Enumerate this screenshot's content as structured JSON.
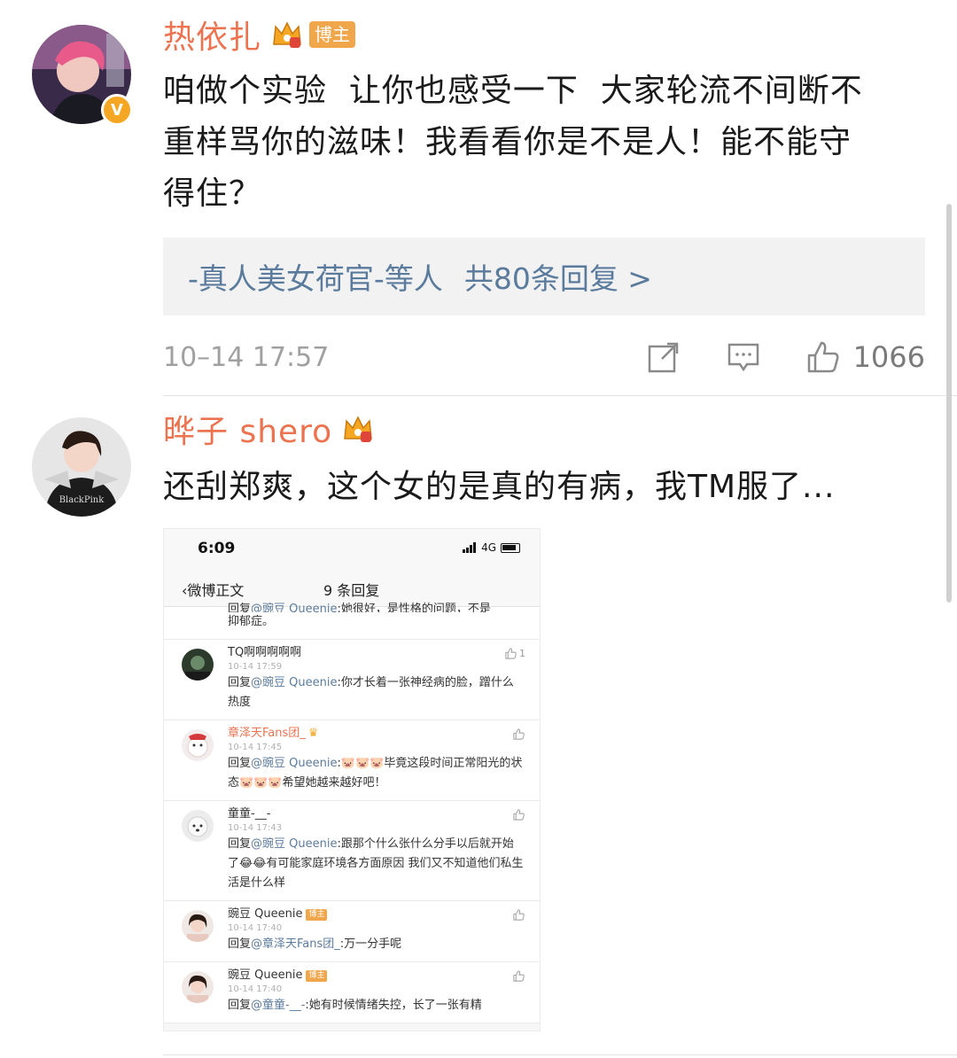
{
  "comments": [
    {
      "username": "热依扎",
      "tag": "博主",
      "verified_badge": "V",
      "lines": [
        "咱做个实验  让你也感受一下  大家轮流不间断不",
        "重样骂你的滋味！我看看你是不是人！能不能守",
        "得住？"
      ],
      "reply_preview": {
        "users": "-真人美女荷官-等人",
        "count_text": "共80条回复 >"
      },
      "timestamp": "10–14 17:57",
      "like_count": "1066",
      "icons": [
        "share-icon",
        "comment-icon",
        "like-icon"
      ]
    },
    {
      "username": "晔子 shero",
      "text": "还刮郑爽，这个女的是真的有病，我TM服了...",
      "embedded_screenshot": {
        "status_time": "6:09",
        "network": "4G",
        "back_label": "微博正文",
        "title": "9 条回复",
        "partial_top": {
          "prefix": "回复",
          "mention": "@豌豆 Queenie",
          "text": ":她很好，是性格的问题，不是",
          "line2": "抑郁症。"
        },
        "items": [
          {
            "name": "TQ啊啊啊啊啊",
            "name_color": "normal",
            "time": "10-14 17:59",
            "like": "1",
            "prefix": "回复",
            "mention": "@豌豆 Queenie",
            "text": ":你才长着一张神经病的脸，蹭什么热度"
          },
          {
            "name": "章泽天Fans团_",
            "name_color": "orange",
            "time": "10-14 17:45",
            "like": "",
            "prefix": "回复",
            "mention": "@豌豆 Queenie",
            "text": ":🐷🐷🐷毕竟这段时间正常阳光的状态🐷🐷🐷希望她越来越好吧！"
          },
          {
            "name": "童童-__-",
            "name_color": "normal",
            "time": "10-14 17:43",
            "like": "",
            "prefix": "回复",
            "mention": "@豌豆 Queenie",
            "text": ":跟那个什么张什么分手以后就开始了😂😂有可能家庭环境各方面原因 我们又不知道他们私生活是什么样"
          },
          {
            "name": "豌豆 Queenie",
            "name_color": "normal",
            "tag": "博主",
            "time": "10-14 17:40",
            "like": "",
            "prefix": "回复",
            "mention": "@章泽天Fans团_",
            "text": ":万一分手呢"
          },
          {
            "name": "豌豆 Queenie",
            "name_color": "normal",
            "tag": "博主",
            "time": "10-14 17:40",
            "like": "",
            "prefix": "回复",
            "mention": "@童童-__-",
            "text": ":她有时候情绪失控，长了一张有精"
          }
        ]
      }
    }
  ]
}
